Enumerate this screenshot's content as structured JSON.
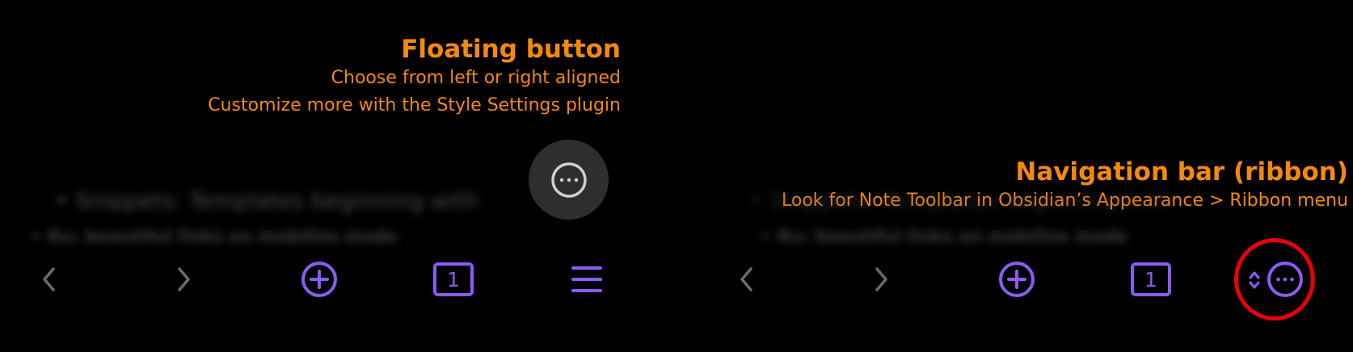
{
  "floating_panel": {
    "title": "Floating button",
    "lines": [
      "Choose from left or right aligned",
      "Customize more with the Style Settings plugin"
    ]
  },
  "ribbon_panel": {
    "title": "Navigation bar (ribbon)",
    "lines": [
      "Look for Note Toolbar in Obsidian’s Appearance > Ribbon menu"
    ]
  },
  "background_text": {
    "line1": "• Snippets: Templates beginning with",
    "line2": "• Ru: beautiful links on mobilize mode"
  },
  "nav_bar": {
    "tab_count": "1",
    "icons": [
      "chevron-left-icon",
      "chevron-right-icon",
      "new-note-icon",
      "tabs-icon",
      "menu-icon"
    ]
  },
  "colors": {
    "background": "#000000",
    "annotation": "#f5890f",
    "accent": "#8a5cf5",
    "inactive": "#6b6b6b",
    "highlight": "#e8000d",
    "floating_button_bg": "#2e2e2e"
  }
}
